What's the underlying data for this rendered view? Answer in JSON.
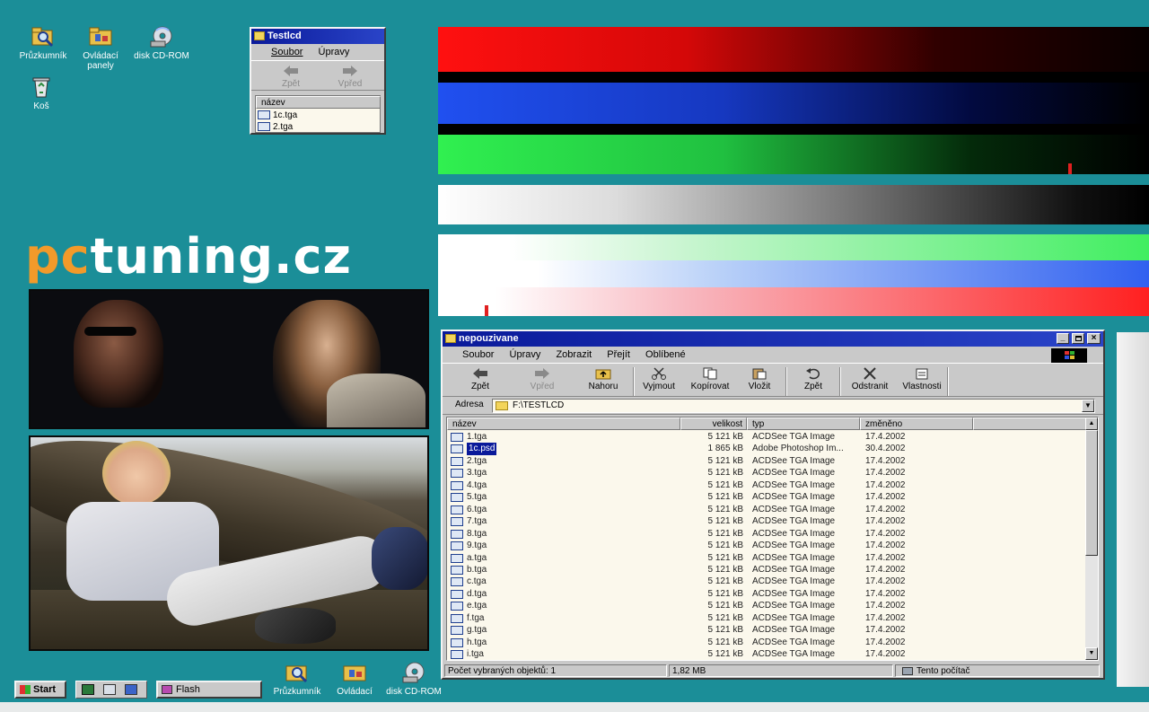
{
  "desktop": {
    "icons_top": [
      {
        "label": "Průzkumník",
        "icon": "explorer-icon"
      },
      {
        "label": "Ovládací panely",
        "icon": "control-panel-icon"
      },
      {
        "label": "disk CD-ROM",
        "icon": "cd-rom-icon"
      },
      {
        "label": "Koš",
        "icon": "recycle-bin-icon"
      }
    ],
    "brand": {
      "part1": "pc",
      "part2": "tuning.cz"
    }
  },
  "small_window": {
    "title": "Testlcd",
    "menu": [
      "Soubor",
      "Úpravy"
    ],
    "back": "Zpět",
    "forward": "Vpřed",
    "column": "název",
    "files": [
      "1c.tga",
      "2.tga"
    ]
  },
  "main_window": {
    "title": "nepouzivane",
    "menu": [
      "Soubor",
      "Úpravy",
      "Zobrazit",
      "Přejít",
      "Oblíbené"
    ],
    "toolbar": [
      "Zpět",
      "Vpřed",
      "Nahoru",
      "Vyjmout",
      "Kopírovat",
      "Vložit",
      "Zpět",
      "Odstranit",
      "Vlastnosti"
    ],
    "address_label": "Adresa",
    "address": "F:\\TESTLCD",
    "columns": {
      "name": "název",
      "size": "velikost",
      "type": "typ",
      "modified": "změněno"
    },
    "files": [
      {
        "name": "1.tga",
        "size": "5 121 kB",
        "type": "ACDSee TGA Image",
        "date": "17.4.2002"
      },
      {
        "name": "1c.psd",
        "size": "1 865 kB",
        "type": "Adobe Photoshop Im...",
        "date": "30.4.2002",
        "selected": true
      },
      {
        "name": "2.tga",
        "size": "5 121 kB",
        "type": "ACDSee TGA Image",
        "date": "17.4.2002"
      },
      {
        "name": "3.tga",
        "size": "5 121 kB",
        "type": "ACDSee TGA Image",
        "date": "17.4.2002"
      },
      {
        "name": "4.tga",
        "size": "5 121 kB",
        "type": "ACDSee TGA Image",
        "date": "17.4.2002"
      },
      {
        "name": "5.tga",
        "size": "5 121 kB",
        "type": "ACDSee TGA Image",
        "date": "17.4.2002"
      },
      {
        "name": "6.tga",
        "size": "5 121 kB",
        "type": "ACDSee TGA Image",
        "date": "17.4.2002"
      },
      {
        "name": "7.tga",
        "size": "5 121 kB",
        "type": "ACDSee TGA Image",
        "date": "17.4.2002"
      },
      {
        "name": "8.tga",
        "size": "5 121 kB",
        "type": "ACDSee TGA Image",
        "date": "17.4.2002"
      },
      {
        "name": "9.tga",
        "size": "5 121 kB",
        "type": "ACDSee TGA Image",
        "date": "17.4.2002"
      },
      {
        "name": "a.tga",
        "size": "5 121 kB",
        "type": "ACDSee TGA Image",
        "date": "17.4.2002"
      },
      {
        "name": "b.tga",
        "size": "5 121 kB",
        "type": "ACDSee TGA Image",
        "date": "17.4.2002"
      },
      {
        "name": "c.tga",
        "size": "5 121 kB",
        "type": "ACDSee TGA Image",
        "date": "17.4.2002"
      },
      {
        "name": "d.tga",
        "size": "5 121 kB",
        "type": "ACDSee TGA Image",
        "date": "17.4.2002"
      },
      {
        "name": "e.tga",
        "size": "5 121 kB",
        "type": "ACDSee TGA Image",
        "date": "17.4.2002"
      },
      {
        "name": "f.tga",
        "size": "5 121 kB",
        "type": "ACDSee TGA Image",
        "date": "17.4.2002"
      },
      {
        "name": "g.tga",
        "size": "5 121 kB",
        "type": "ACDSee TGA Image",
        "date": "17.4.2002"
      },
      {
        "name": "h.tga",
        "size": "5 121 kB",
        "type": "ACDSee TGA Image",
        "date": "17.4.2002"
      },
      {
        "name": "i.tga",
        "size": "5 121 kB",
        "type": "ACDSee TGA Image",
        "date": "17.4.2002"
      }
    ],
    "status": {
      "count": "Počet vybraných objektů: 1",
      "size": "1,82 MB",
      "location": "Tento počítač"
    }
  },
  "taskbar": {
    "start": "Start",
    "task": "Flash",
    "icons": [
      {
        "label": "Průzkumník",
        "icon": "explorer-icon"
      },
      {
        "label": "Ovládací",
        "icon": "control-panel-icon"
      },
      {
        "label": "disk CD-ROM",
        "icon": "cd-rom-icon"
      }
    ]
  }
}
